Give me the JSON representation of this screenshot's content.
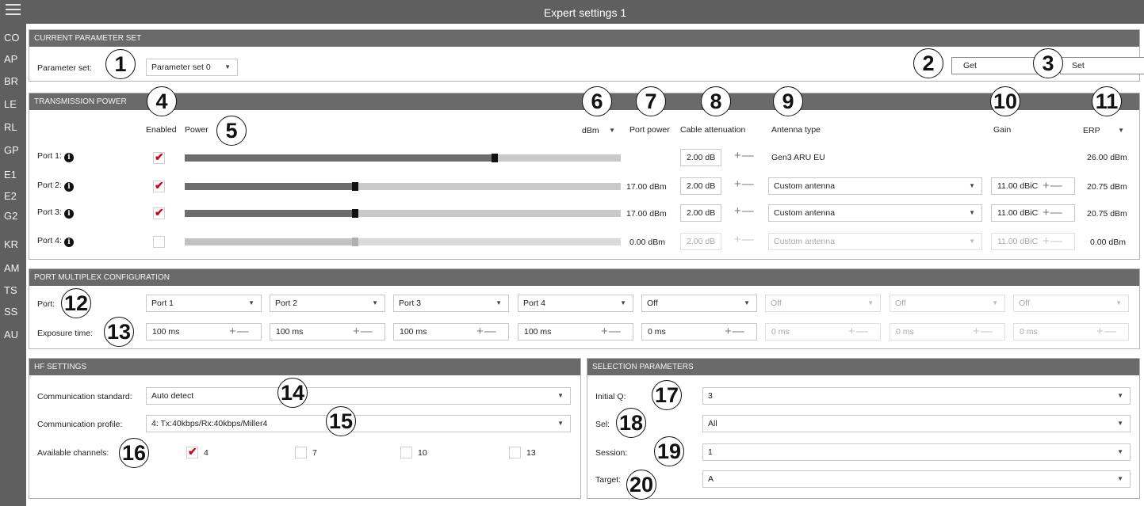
{
  "window": {
    "title": "Expert settings 1"
  },
  "sidebar": {
    "items": [
      "CO",
      "AP",
      "BR",
      "LE",
      "RL",
      "GP",
      "E1",
      "E2",
      "G2",
      "KR",
      "AM",
      "TS",
      "SS",
      "AU"
    ]
  },
  "param_set": {
    "header": "CURRENT PARAMETER SET",
    "label": "Parameter set:",
    "value": "Parameter set 0",
    "get_label": "Get",
    "set_label": "Set"
  },
  "tx_power": {
    "header": "TRANSMISSION POWER",
    "col_enabled": "Enabled",
    "col_power": "Power",
    "unit": "dBm",
    "col_port_power": "Port power",
    "col_cable": "Cable attenuation",
    "col_antenna": "Antenna type",
    "col_gain": "Gain",
    "erp": "ERP",
    "ports": [
      {
        "label": "Port 1:",
        "enabled": true,
        "level": 0.71,
        "port_power": "",
        "cable": "2.00 dB",
        "antenna": "Gen3 ARU EU",
        "gain": "",
        "erp": "26.00 dBm"
      },
      {
        "label": "Port 2:",
        "enabled": true,
        "level": 0.39,
        "port_power": "17.00 dBm",
        "cable": "2.00 dB",
        "antenna": "Custom antenna",
        "gain": "11.00 dBiC",
        "erp": "20.75 dBm"
      },
      {
        "label": "Port 3:",
        "enabled": true,
        "level": 0.39,
        "port_power": "17.00 dBm",
        "cable": "2.00 dB",
        "antenna": "Custom antenna",
        "gain": "11.00 dBiC",
        "erp": "20.75 dBm"
      },
      {
        "label": "Port 4:",
        "enabled": false,
        "level": 0.39,
        "port_power": "0.00 dBm",
        "cable": "2.00 dB",
        "antenna": "Custom antenna",
        "gain": "11.00 dBiC",
        "erp": "0.00 dBm"
      }
    ]
  },
  "multiplex": {
    "header": "PORT MULTIPLEX CONFIGURATION",
    "port_label": "Port:",
    "exposure_label": "Exposure time:",
    "ports": [
      "Port 1",
      "Port 2",
      "Port 3",
      "Port 4",
      "Off",
      "Off",
      "Off",
      "Off"
    ],
    "exposure": [
      "100 ms",
      "100 ms",
      "100 ms",
      "100 ms",
      "0 ms",
      "0 ms",
      "0 ms",
      "0 ms"
    ]
  },
  "hf": {
    "header": "HF SETTINGS",
    "standard_label": "Communication standard:",
    "standard_value": "Auto detect",
    "profile_label": "Communication profile:",
    "profile_value": "4: Tx:40kbps/Rx:40kbps/Miller4",
    "channels_label": "Available channels:",
    "channels": [
      {
        "label": "4",
        "checked": true
      },
      {
        "label": "7",
        "checked": false
      },
      {
        "label": "10",
        "checked": false
      },
      {
        "label": "13",
        "checked": false
      }
    ]
  },
  "selection": {
    "header": "SELECTION PARAMETERS",
    "initial_q_label": "Initial Q:",
    "initial_q_value": "3",
    "sel_label": "Sel:",
    "sel_value": "All",
    "session_label": "Session:",
    "session_value": "1",
    "target_label": "Target:",
    "target_value": "A"
  },
  "callouts": [
    "1",
    "2",
    "3",
    "4",
    "5",
    "6",
    "7",
    "8",
    "9",
    "10",
    "11",
    "12",
    "13",
    "14",
    "15",
    "16",
    "17",
    "18",
    "19",
    "20"
  ],
  "icons": {
    "menu": "hamburger-menu-icon",
    "info": "info-circle-icon",
    "caret": "caret-down-icon",
    "check": "checkmark-icon"
  },
  "colors": {
    "chrome": "#5f5f5f",
    "panel_header": "#6a6a6a",
    "check": "#d0021b",
    "slider_fill": "#6d6d6d",
    "slider_track": "#c9c9c9"
  }
}
